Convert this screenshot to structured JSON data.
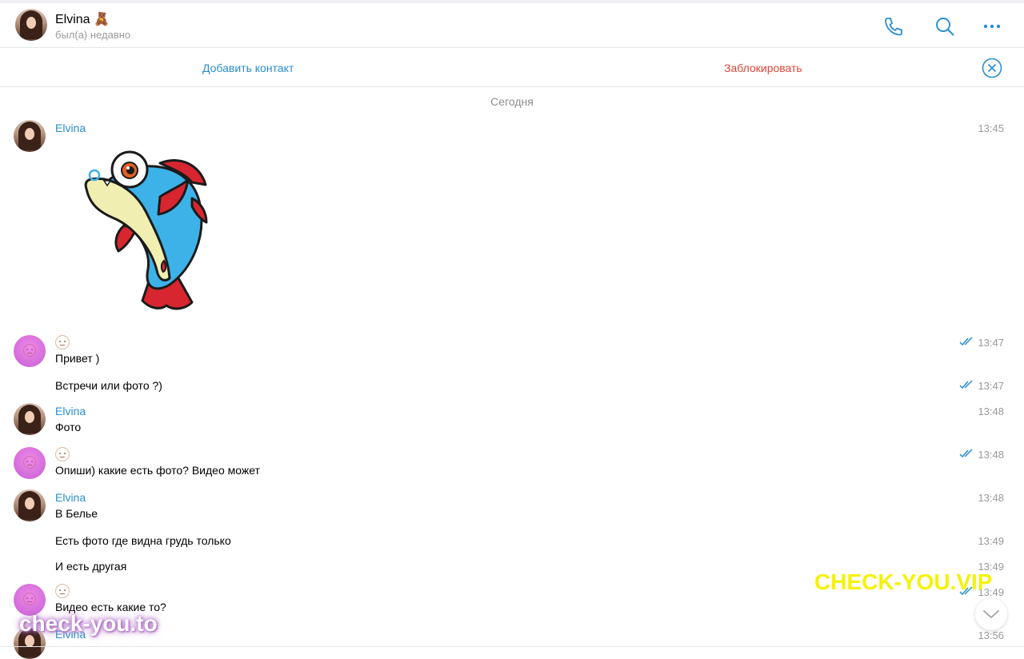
{
  "header": {
    "name": "Elvina 🧸",
    "status": "был(а) недавно",
    "icons": [
      "phone-icon",
      "search-icon",
      "more-icon"
    ]
  },
  "actions": {
    "add_contact": "Добавить контакт",
    "block": "Заблокировать"
  },
  "date_separator": "Сегодня",
  "messages": [
    {
      "sender": "Elvina",
      "time": "13:45"
    },
    {
      "time": "13:47",
      "text": "Привет )"
    },
    {
      "time": "13:47",
      "text": "Встречи или фото ?)"
    },
    {
      "sender": "Elvina",
      "time": "13:48",
      "text": "Фото"
    },
    {
      "time": "13:48",
      "text": "Опиши) какие есть фото? Видео может"
    },
    {
      "sender": "Elvina",
      "time": "13:48",
      "text": "В Белье"
    },
    {
      "time": "13:49",
      "text": "Есть фото где видна грудь только"
    },
    {
      "time": "13:49",
      "text": "И есть другая"
    },
    {
      "time": "13:49",
      "text": "Видео есть какие то?"
    },
    {
      "sender": "Elvina",
      "time": "13:56"
    }
  ],
  "watermarks": {
    "right": "CHECK-YOU.VIP",
    "left": "check-you.to"
  },
  "colors": {
    "link_blue": "#2a8ed1",
    "block_red": "#e0453a",
    "watermark_yellow": "#f4f20a"
  }
}
